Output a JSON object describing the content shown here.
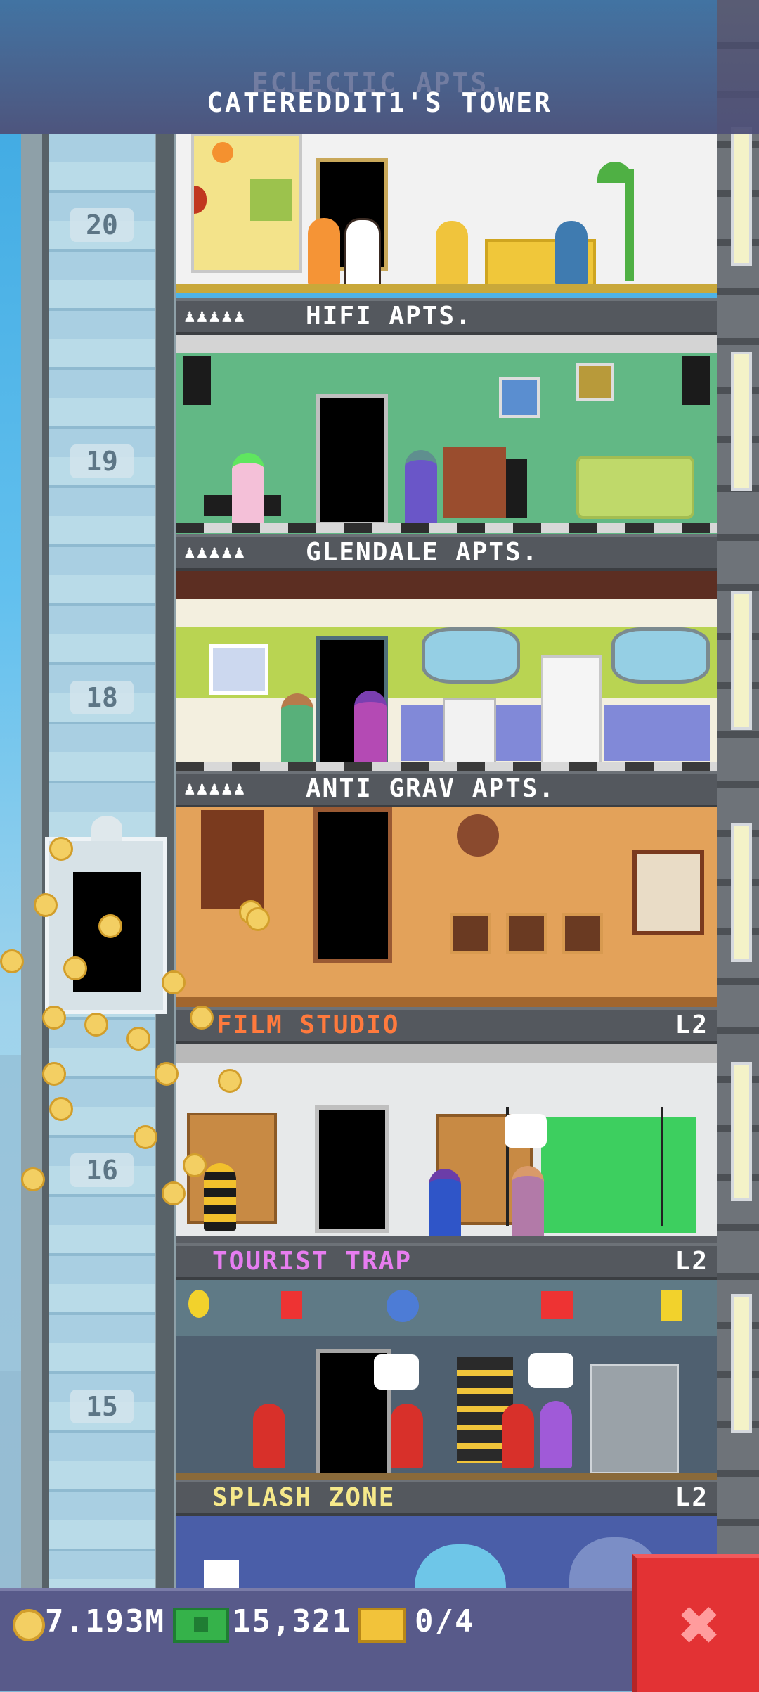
{
  "header": {
    "tower_title": "CATEREDDIT1'S TOWER",
    "prev_floor_name": "ECLECTIC APTS."
  },
  "shaft": {
    "floor_numbers": [
      "20",
      "19",
      "18",
      "16",
      "15"
    ]
  },
  "floors": [
    {
      "name": "HIFI APTS.",
      "people_icons": "♟♟♟♟♟",
      "level": ""
    },
    {
      "name": "GLENDALE APTS.",
      "people_icons": "♟♟♟♟♟",
      "level": ""
    },
    {
      "name": "ANTI GRAV APTS.",
      "people_icons": "♟♟♟♟♟",
      "level": ""
    },
    {
      "name": "FILM STUDIO",
      "people_icons": "",
      "level": "L2"
    },
    {
      "name": "TOURIST TRAP",
      "people_icons": "",
      "level": "L2"
    },
    {
      "name": "SPLASH ZONE",
      "people_icons": "",
      "level": "L2"
    }
  ],
  "stats": {
    "coins": "7.193M",
    "bux": "15,321",
    "tickets": "0/4"
  },
  "icons": {
    "coin": "coin-icon",
    "bux": "bux-icon",
    "ticket": "ticket-icon",
    "close": "close-icon"
  },
  "colors": {
    "sign_bg": "#54585e",
    "residential_label": "#ffffff",
    "film_label": "#ff7a3d",
    "tourist_label": "#e77df0",
    "splash_label": "#f6e98a",
    "close_button": "#e33234"
  }
}
